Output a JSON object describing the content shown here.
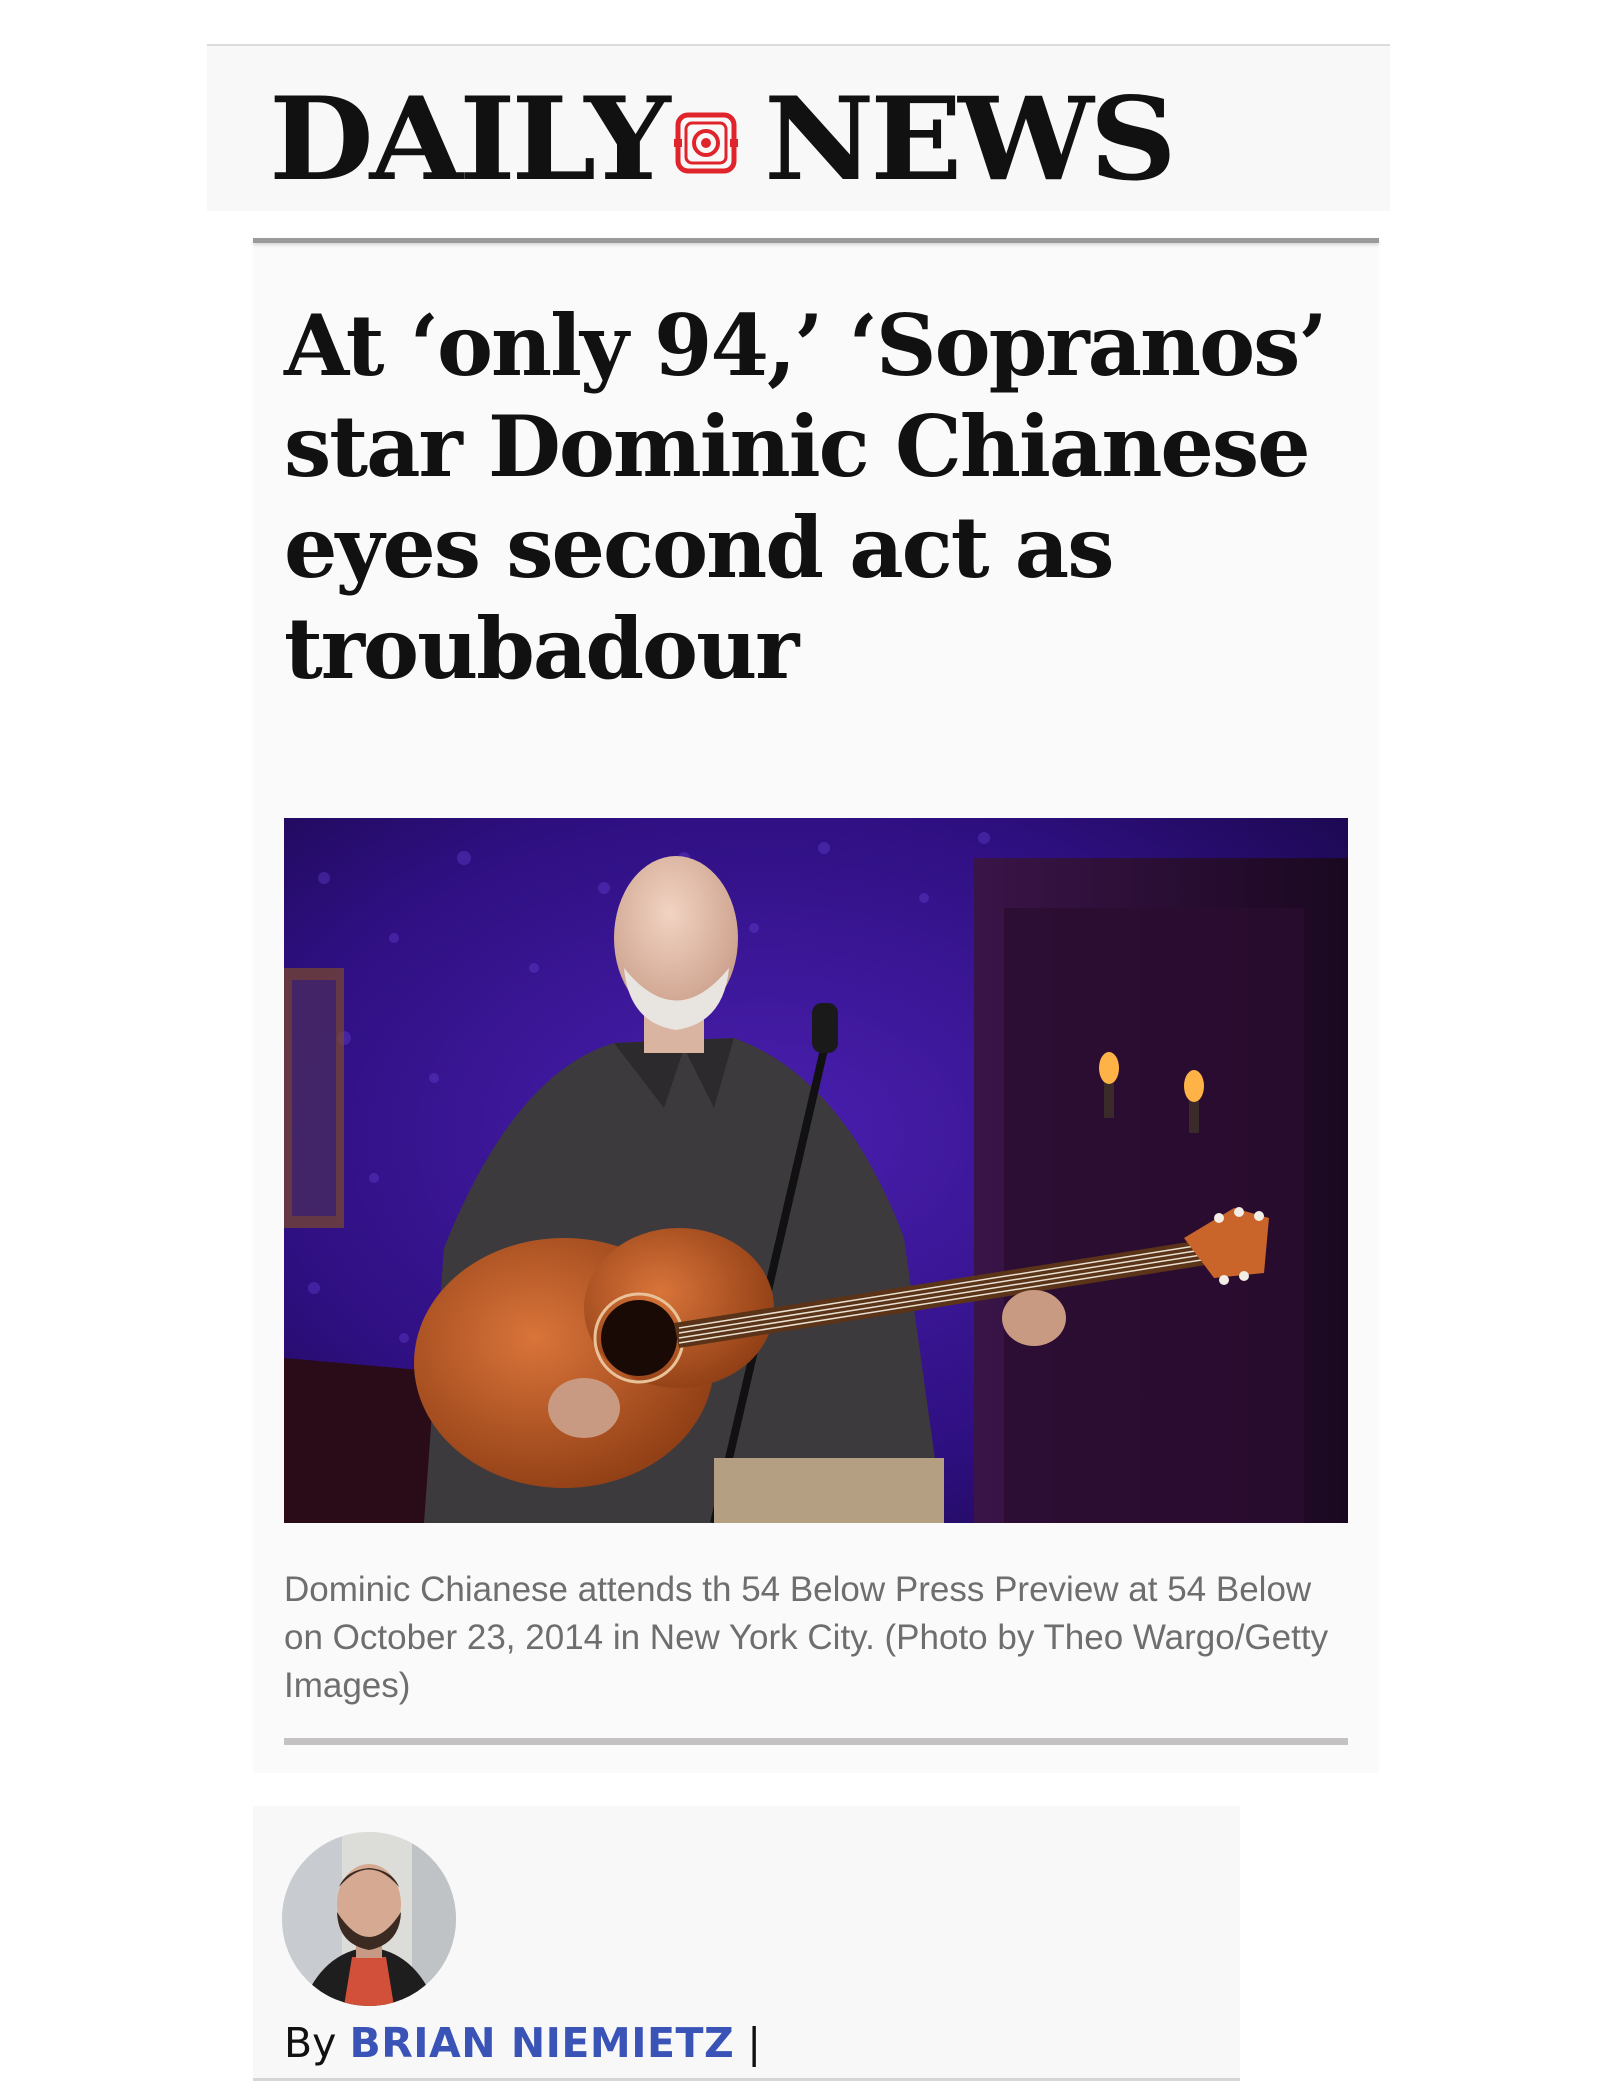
{
  "masthead": {
    "word_left": "DAILY",
    "word_right": "NEWS",
    "logo_icon": "camera-logo-icon",
    "logo_color": "#e0242b"
  },
  "article": {
    "headline": "At ‘only 94,’ ‘Sopranos’ star Dominic Chianese eyes second act as troubadour",
    "photo_icon": "guitarist-on-stage-photo",
    "caption": "Dominic Chianese attends th 54 Below Press Preview at 54 Below on October 23, 2014 in New York City. (Photo by Theo Wargo/Getty Images)"
  },
  "byline": {
    "prefix": "By",
    "author": "BRIAN NIEMIETZ",
    "separator": "|",
    "author_color": "#3a53b7"
  }
}
